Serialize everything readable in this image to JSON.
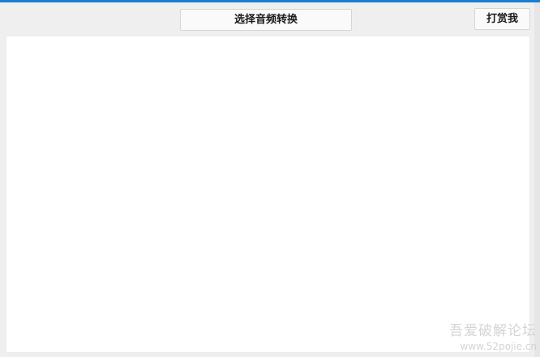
{
  "toolbar": {
    "select_audio_label": "选择音频转换",
    "reward_label": "打赏我"
  },
  "watermark": {
    "line1": "吾爱破解论坛",
    "line2": "www.52pojie.cn"
  },
  "colors": {
    "accent": "#1a7ed4",
    "window_background": "#efefef",
    "content_background": "#ffffff"
  }
}
